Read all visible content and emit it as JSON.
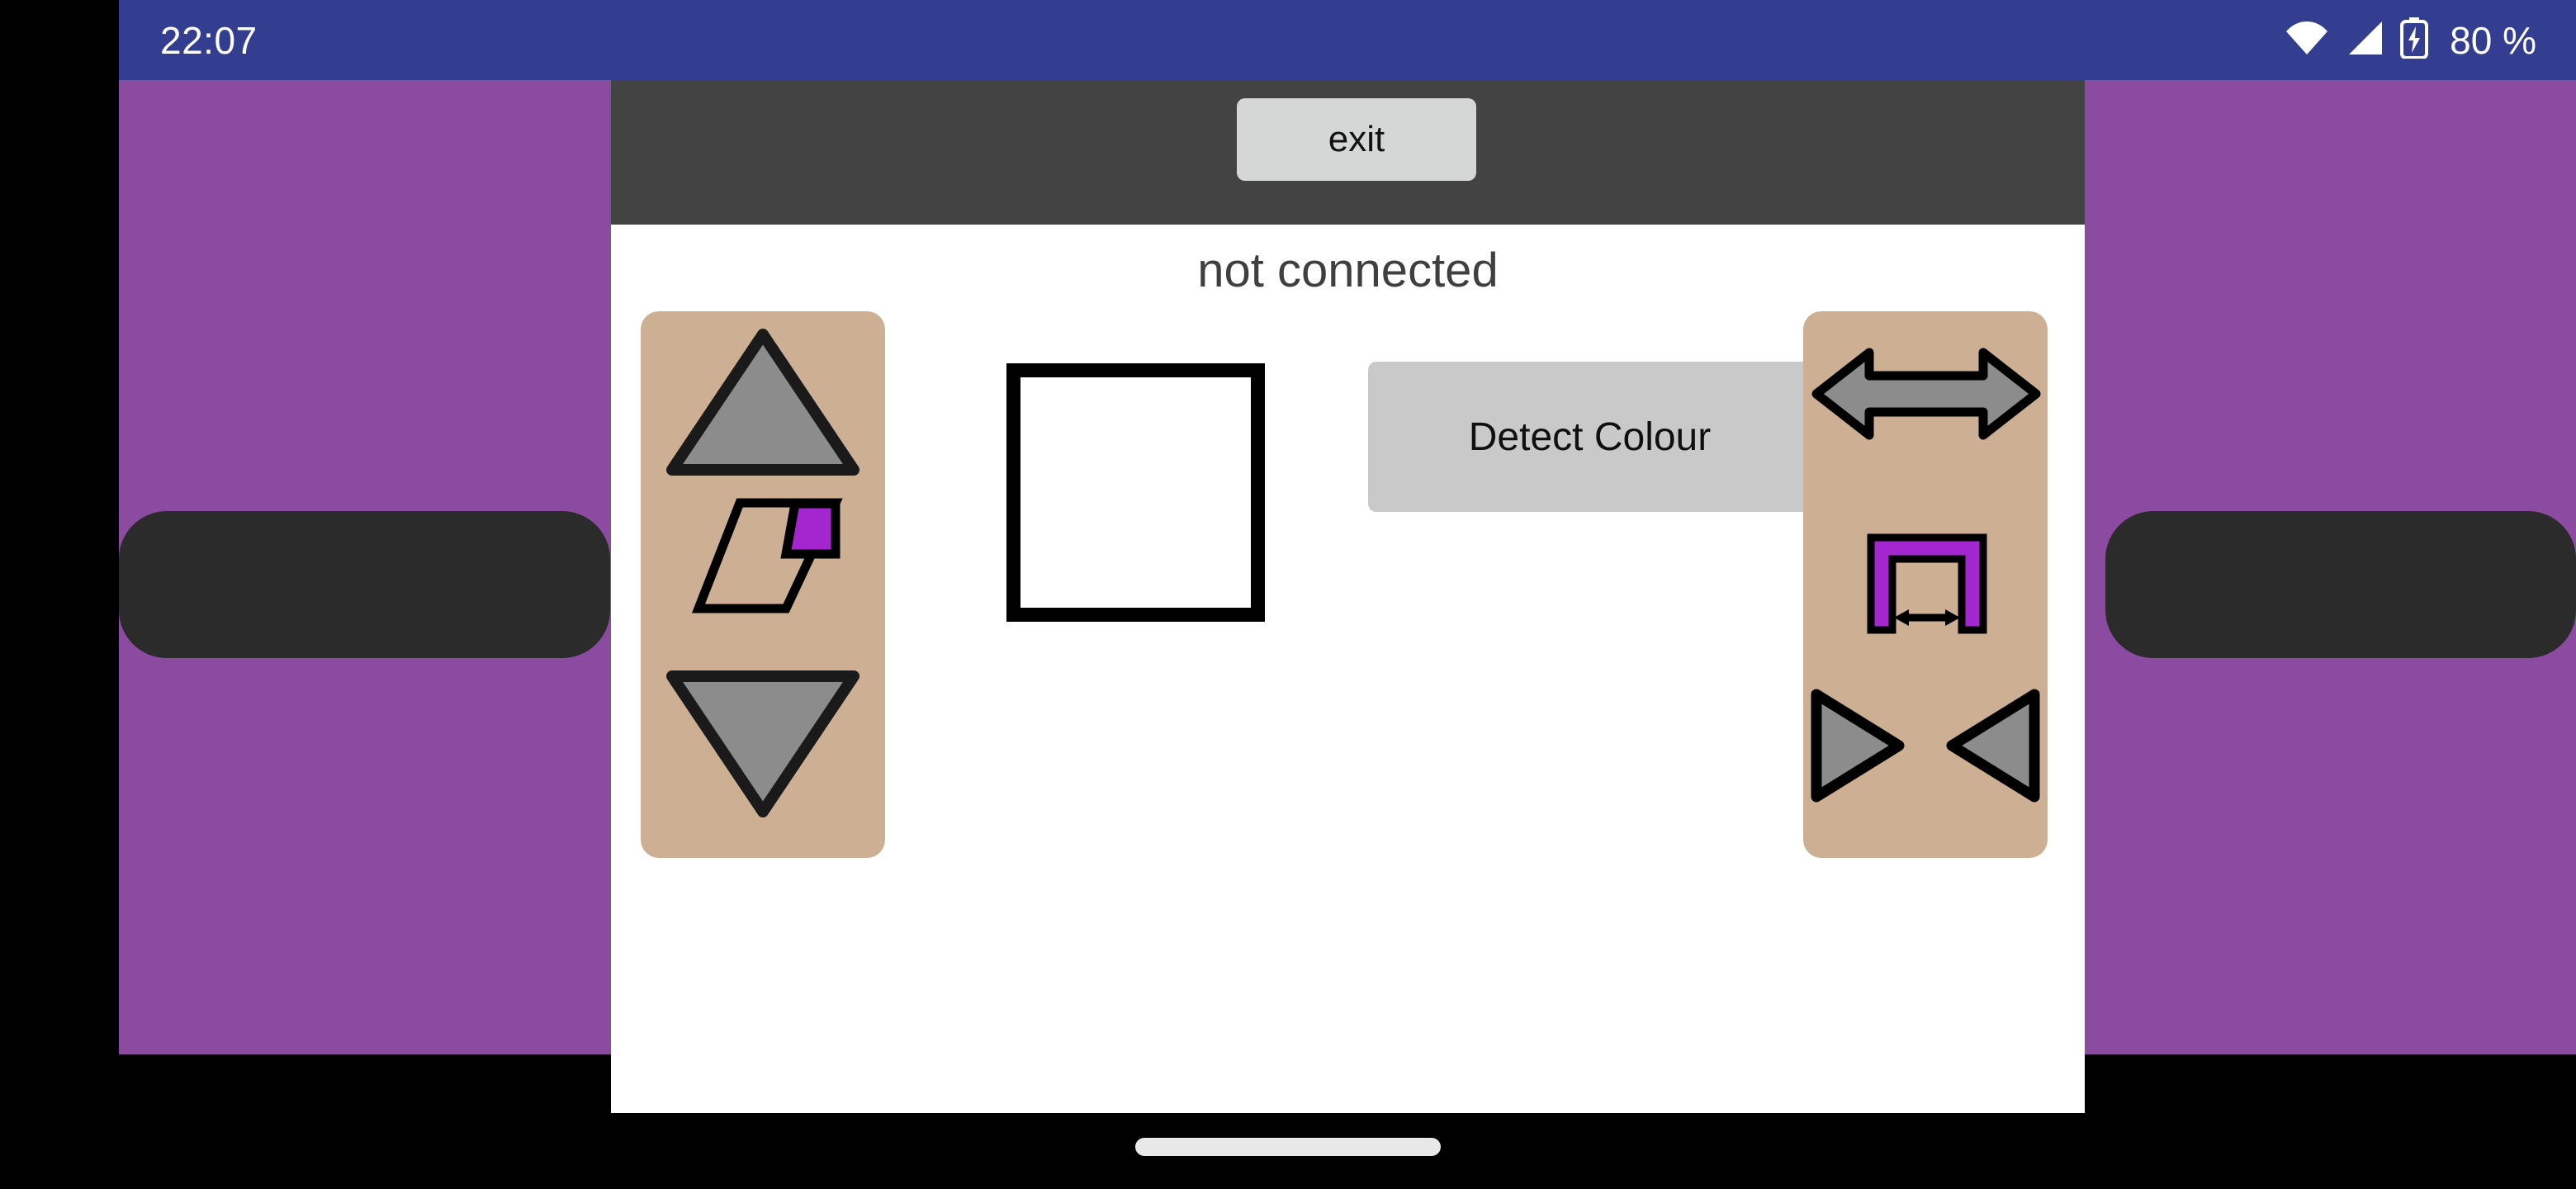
{
  "status_bar": {
    "clock": "22:07",
    "battery_percent": "80 %",
    "icons": [
      "wifi-icon",
      "cellular-signal-icon",
      "battery-charging-icon"
    ],
    "background_color": "#343E91",
    "foreground_color": "#FFFFFF"
  },
  "wallpaper": {
    "color": "#8A4BA0",
    "widgets": [
      {
        "name": "dark-pill-left",
        "color": "#2B2B2B"
      },
      {
        "name": "dark-pill-right",
        "color": "#2B2B2B"
      }
    ]
  },
  "app": {
    "toolbar": {
      "background_color": "#434343",
      "exit_label": "exit",
      "exit_background": "#D5D7D6"
    },
    "content": {
      "background_color": "#FFFFFF",
      "connection_status": "not connected",
      "detect_colour_label": "Detect Colour",
      "detect_colour_background": "#C9C9C9",
      "swatch": {
        "name": "detected-colour-swatch",
        "fill": "#FFFFFF",
        "border": "#000000"
      }
    },
    "panels": {
      "background_color": "#CDB094",
      "shape_fill": "#8C8C8C",
      "shape_stroke": "#000000",
      "accent_purple": "#A426CF",
      "left": {
        "name": "vertical-movement-panel",
        "controls": [
          {
            "name": "move-up-button",
            "icon": "triangle-up-icon"
          },
          {
            "name": "tilt-adjust-button",
            "icon": "parallelogram-with-purple-corner-icon"
          },
          {
            "name": "move-down-button",
            "icon": "triangle-down-icon"
          }
        ]
      },
      "right": {
        "name": "horizontal-movement-panel",
        "controls": [
          {
            "name": "spread-button",
            "icon": "double-arrow-horizontal-icon"
          },
          {
            "name": "width-adjust-button",
            "icon": "purple-bracket-width-icon"
          },
          {
            "name": "rotate-right-button",
            "icon": "triangle-right-icon"
          },
          {
            "name": "rotate-left-button",
            "icon": "triangle-left-icon"
          }
        ]
      }
    }
  },
  "navigation_bar": {
    "name": "gesture-navigation-bar",
    "pill_color": "#E8E8E8",
    "background_color": "#000000"
  }
}
